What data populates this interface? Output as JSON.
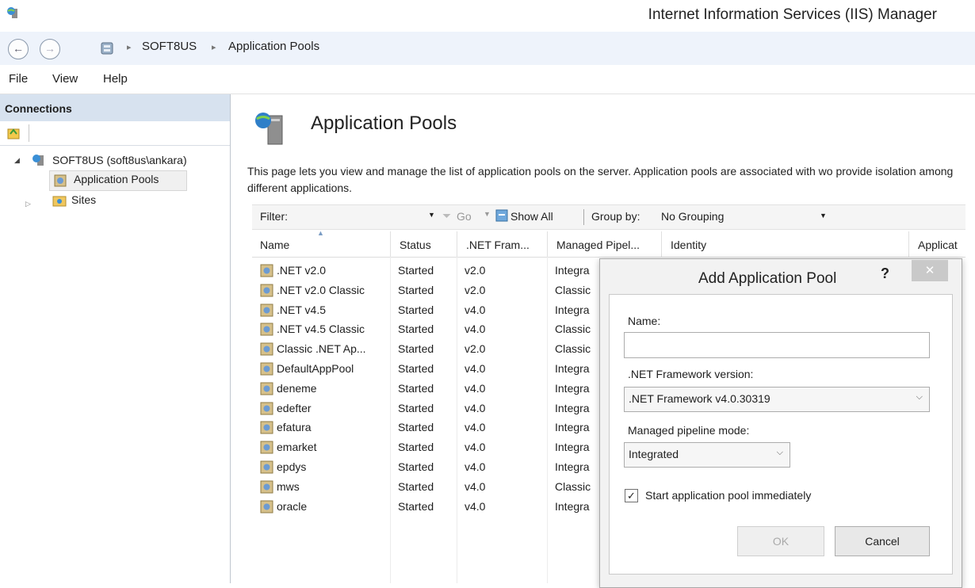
{
  "window": {
    "title": "Internet Information Services (IIS) Manager"
  },
  "address": {
    "crumbs": [
      "SOFT8US",
      "Application Pools"
    ]
  },
  "menu": {
    "items": [
      "File",
      "View",
      "Help"
    ]
  },
  "connections": {
    "title": "Connections",
    "tree": {
      "server": "SOFT8US (soft8us\\ankara)",
      "app_pools": "Application Pools",
      "sites": "Sites"
    }
  },
  "main": {
    "title": "Application Pools",
    "description": "This page lets you view and manage the list of application pools on the server. Application pools are associated with wo provide isolation among different applications.",
    "filter": {
      "label": "Filter:",
      "go": "Go",
      "show_all": "Show All",
      "group_by_label": "Group by:",
      "group_by_value": "No Grouping"
    },
    "columns": [
      "Name",
      "Status",
      ".NET Fram...",
      "Managed Pipel...",
      "Identity",
      "Applicat"
    ],
    "rows": [
      {
        "name": ".NET v2.0",
        "status": "Started",
        "net": "v2.0",
        "pipeline": "Integra"
      },
      {
        "name": ".NET v2.0 Classic",
        "status": "Started",
        "net": "v2.0",
        "pipeline": "Classic"
      },
      {
        "name": ".NET v4.5",
        "status": "Started",
        "net": "v4.0",
        "pipeline": "Integra"
      },
      {
        "name": ".NET v4.5 Classic",
        "status": "Started",
        "net": "v4.0",
        "pipeline": "Classic"
      },
      {
        "name": "Classic .NET Ap...",
        "status": "Started",
        "net": "v2.0",
        "pipeline": "Classic"
      },
      {
        "name": "DefaultAppPool",
        "status": "Started",
        "net": "v4.0",
        "pipeline": "Integra"
      },
      {
        "name": "deneme",
        "status": "Started",
        "net": "v4.0",
        "pipeline": "Integra"
      },
      {
        "name": "edefter",
        "status": "Started",
        "net": "v4.0",
        "pipeline": "Integra"
      },
      {
        "name": "efatura",
        "status": "Started",
        "net": "v4.0",
        "pipeline": "Integra"
      },
      {
        "name": "emarket",
        "status": "Started",
        "net": "v4.0",
        "pipeline": "Integra"
      },
      {
        "name": "epdys",
        "status": "Started",
        "net": "v4.0",
        "pipeline": "Integra"
      },
      {
        "name": "mws",
        "status": "Started",
        "net": "v4.0",
        "pipeline": "Classic"
      },
      {
        "name": "oracle",
        "status": "Started",
        "net": "v4.0",
        "pipeline": "Integra"
      }
    ]
  },
  "dialog": {
    "title": "Add Application Pool",
    "help": "?",
    "close": "✕",
    "name_label": "Name:",
    "name_value": "",
    "framework_label": ".NET Framework version:",
    "framework_value": ".NET Framework v4.0.30319",
    "pipeline_label": "Managed pipeline mode:",
    "pipeline_value": "Integrated",
    "start_label": "Start application pool immediately",
    "start_checked": true,
    "ok": "OK",
    "cancel": "Cancel"
  },
  "colors": {
    "accent": "#d7e2ef",
    "address_bg": "#eef3fb"
  }
}
